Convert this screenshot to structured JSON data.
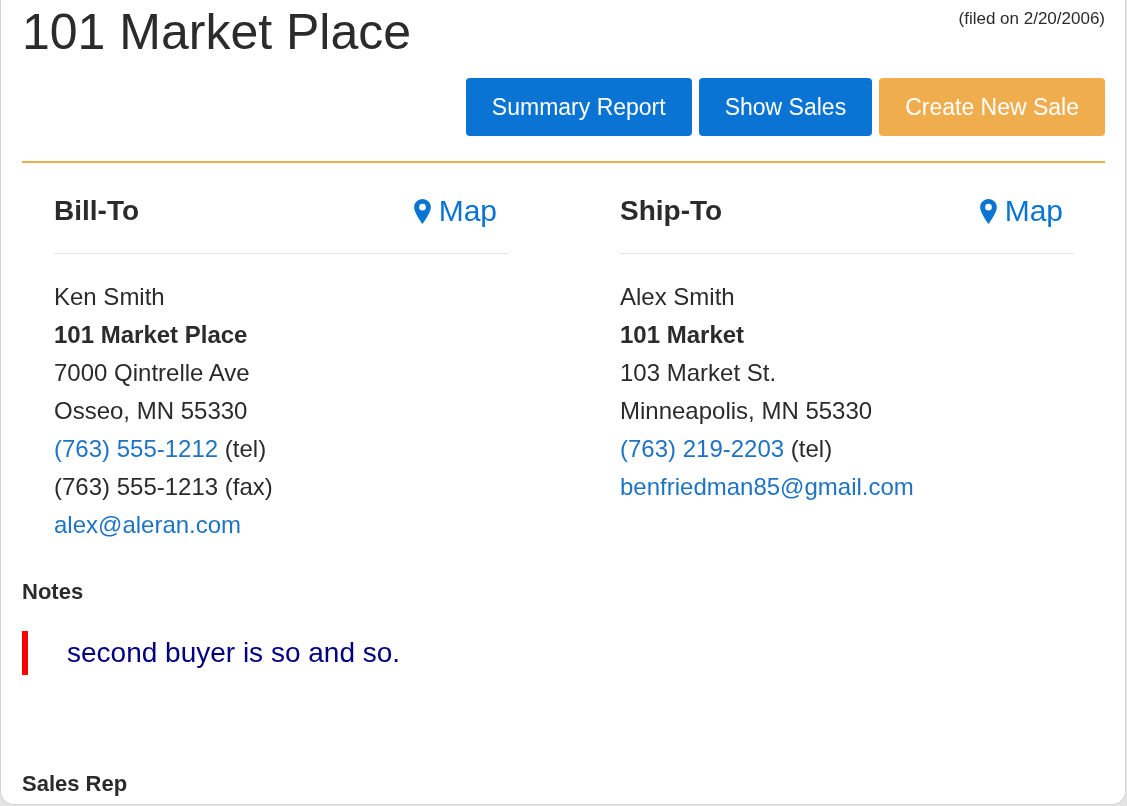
{
  "header": {
    "title": "101 Market Place",
    "filed": "(filed on 2/20/2006)"
  },
  "actions": [
    {
      "label": "Summary Report",
      "kind": "primary"
    },
    {
      "label": "Show Sales",
      "kind": "primary"
    },
    {
      "label": "Create New Sale",
      "kind": "warning"
    }
  ],
  "addresses": [
    {
      "heading": "Bill-To",
      "map_link": "Map",
      "lines": [
        {
          "kind": "text",
          "text": "Ken Smith"
        },
        {
          "kind": "bold",
          "text": "101 Market Place"
        },
        {
          "kind": "text",
          "text": "7000 Qintrelle Ave"
        },
        {
          "kind": "text",
          "text": "Osseo, MN 55330"
        },
        {
          "kind": "phone",
          "number": "(763) 555-1212",
          "label": "(tel)"
        },
        {
          "kind": "text",
          "text": "(763) 555-1213 (fax)"
        },
        {
          "kind": "email",
          "text": "alex@aleran.com"
        }
      ]
    },
    {
      "heading": "Ship-To",
      "map_link": "Map",
      "lines": [
        {
          "kind": "text",
          "text": "Alex Smith"
        },
        {
          "kind": "bold",
          "text": "101 Market"
        },
        {
          "kind": "text",
          "text": "103 Market St."
        },
        {
          "kind": "text",
          "text": "Minneapolis, MN 55330"
        },
        {
          "kind": "phone",
          "number": "(763) 219-2203",
          "label": "(tel)"
        },
        {
          "kind": "email",
          "text": "benfriedman85@gmail.com"
        }
      ]
    }
  ],
  "notes": {
    "heading": "Notes",
    "quote": "second buyer is so and so."
  },
  "sales_rep": {
    "heading": "Sales Rep"
  }
}
